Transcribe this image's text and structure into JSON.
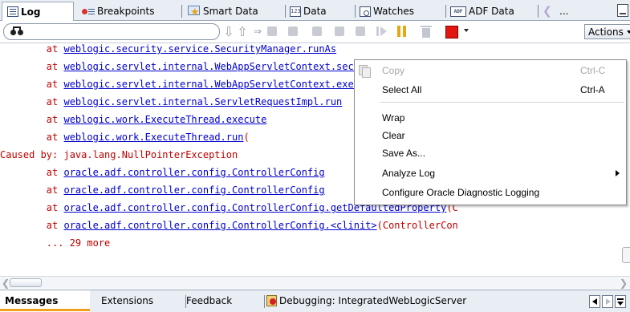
{
  "top_tabs": [
    {
      "label": "Log",
      "icon": "log-icon"
    },
    {
      "label": "Breakpoints",
      "icon": "breakpoints-icon"
    },
    {
      "label": "Smart Data",
      "icon": "smart-data-icon"
    },
    {
      "label": "Data",
      "icon": "data-icon"
    },
    {
      "label": "Watches",
      "icon": "watches-icon"
    },
    {
      "label": "ADF Data",
      "icon": "adf-data-icon",
      "icon_text": "ADF"
    },
    {
      "label": "...",
      "icon": "more-tabs-icon"
    }
  ],
  "data_icon_text": "123",
  "toolbar": {
    "actions_label": "Actions",
    "icons": [
      "binoculars-icon",
      "arrow-down-icon",
      "arrow-up-icon",
      "pause-icon",
      "resume-icon",
      "trash-icon",
      "stop-icon"
    ],
    "accent_pause": "#e5a812",
    "accent_stop": "#e0160f"
  },
  "log_lines": [
    {
      "pre": "        at ",
      "link": "weblogic.security.service.SecurityManager.runAs",
      "post": ""
    },
    {
      "pre": "        at ",
      "link": "weblogic.servlet.internal.WebAppServletContext.securedExecute",
      "post": ""
    },
    {
      "pre": "        at ",
      "link": "weblogic.servlet.internal.WebAppServletContext.execute",
      "post": ""
    },
    {
      "pre": "        at ",
      "link": "weblogic.servlet.internal.ServletRequestImpl.run",
      "post": ""
    },
    {
      "pre": "        at ",
      "link": "weblogic.work.ExecuteThread.execute",
      "post": ""
    },
    {
      "pre": "        at ",
      "link": "weblogic.work.ExecuteThread.run",
      "post": "("
    },
    {
      "pre": "Caused by: java.lang.NullPointerException",
      "link": "",
      "post": ""
    },
    {
      "pre": "        at ",
      "link": "oracle.adf.controller.config.ControllerConfig",
      "post": ""
    },
    {
      "pre": "        at ",
      "link": "oracle.adf.controller.config.ControllerConfig",
      "post": ""
    },
    {
      "pre": "        at ",
      "link": "oracle.adf.controller.config.ControllerConfig.getDefaultedProperty",
      "post": "(C"
    },
    {
      "pre": "        at ",
      "link": "oracle.adf.controller.config.ControllerConfig.<clinit>",
      "post": "(ControllerCon"
    },
    {
      "pre": "        ... 29 more",
      "link": "",
      "post": ""
    }
  ],
  "log_colors": {
    "text": "#c00000",
    "link": "#0000cc"
  },
  "context_menu": {
    "items": [
      {
        "label": "Copy",
        "shortcut": "Ctrl-C",
        "disabled": true,
        "icon": "copy-icon"
      },
      {
        "label": "Select All",
        "shortcut": "Ctrl-A",
        "disabled": false
      },
      {
        "label": "Wrap",
        "shortcut": "",
        "disabled": false
      },
      {
        "label": "Clear",
        "shortcut": "",
        "disabled": false
      },
      {
        "label": "Save As...",
        "shortcut": "",
        "disabled": false
      },
      {
        "label": "Analyze Log",
        "shortcut": "",
        "disabled": false,
        "submenu": true
      },
      {
        "label": "Configure Oracle Diagnostic Logging",
        "shortcut": "",
        "disabled": false
      }
    ]
  },
  "bottom_tabs": [
    {
      "label": "Messages"
    },
    {
      "label": "Extensions"
    },
    {
      "label": "Feedback"
    },
    {
      "label": "Debugging: IntegratedWebLogicServer",
      "icon": "debug-icon"
    }
  ],
  "accent_tab_underline": "#f0a01e"
}
